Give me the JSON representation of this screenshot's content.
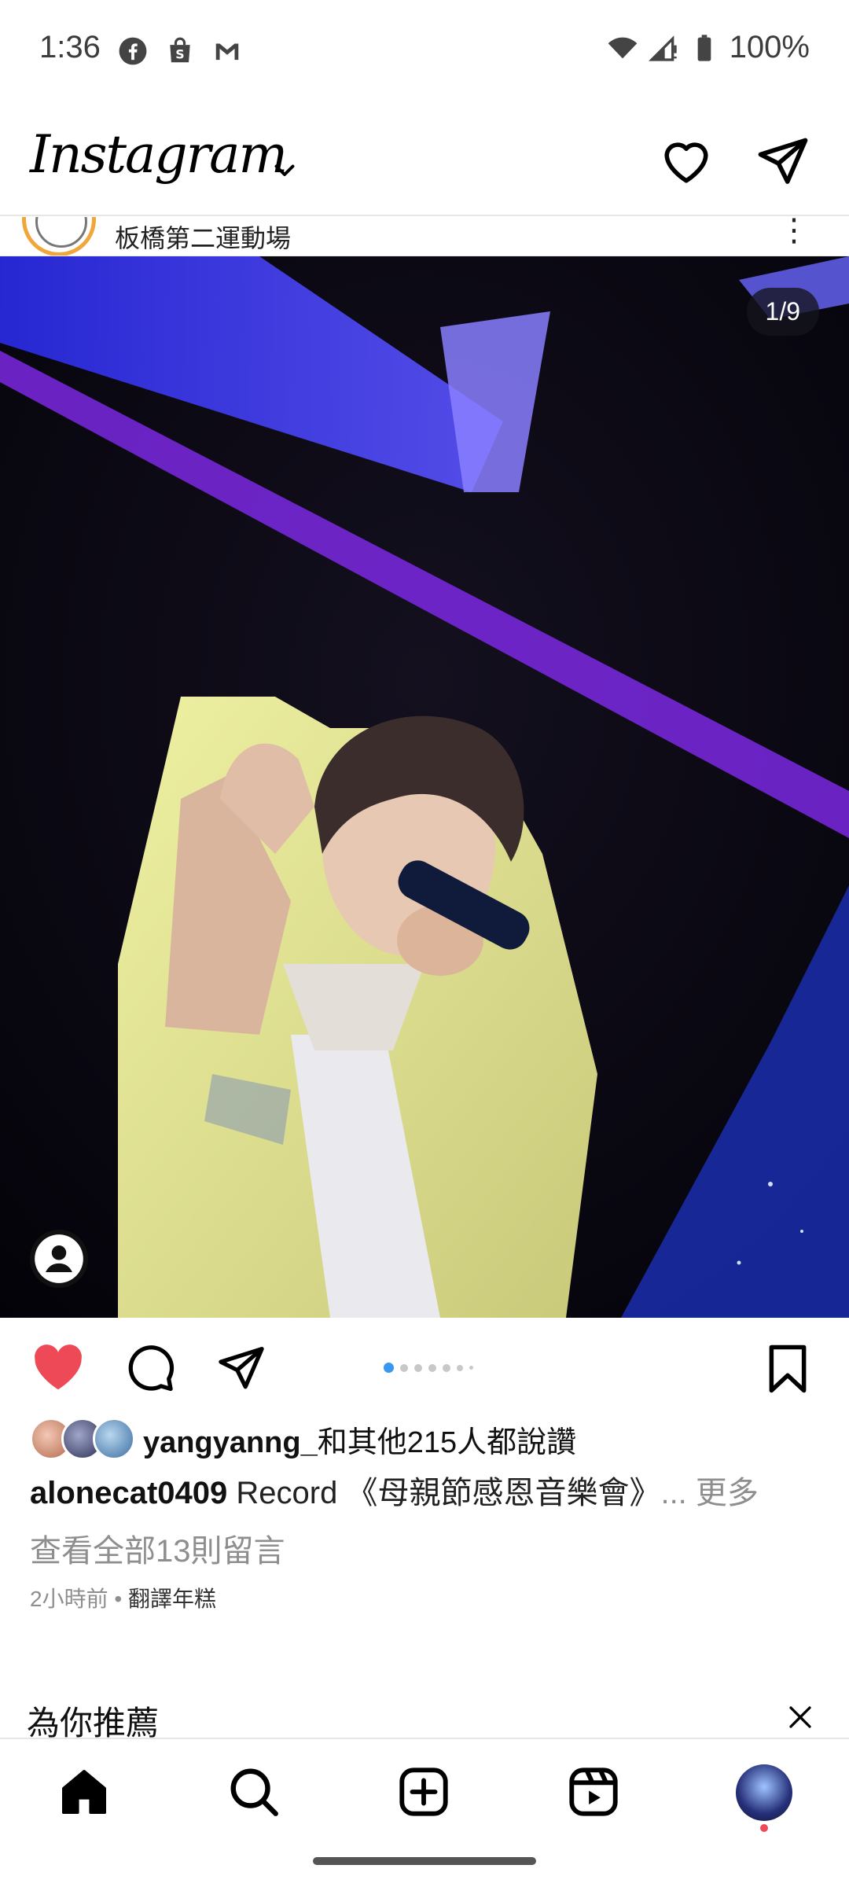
{
  "status_bar": {
    "time": "1:36",
    "app_icons": [
      "facebook-icon",
      "shop-icon",
      "gmail-icon"
    ],
    "battery": "100%"
  },
  "header": {
    "logo": "Instagram",
    "icons": [
      "activity-heart-icon",
      "direct-message-icon"
    ]
  },
  "post": {
    "location": "板橋第二運動場",
    "counter": "1/9",
    "carousel": {
      "total": 9,
      "current": 1,
      "visible_dots": 7
    },
    "likes": {
      "user": "yangyanng_",
      "rest": "和其他215人都說讚"
    },
    "caption": {
      "username": "alonecat0409",
      "text": " Record 《母親節感恩音樂會》",
      "ellipsis": "... ",
      "more": "更多"
    },
    "view_comments": "查看全部13則留言",
    "time_ago": "2小時前",
    "separator": " • ",
    "translate": "翻譯年糕",
    "liked": true
  },
  "suggestions": {
    "title": "為你推薦"
  },
  "bottom_nav": {
    "items": [
      "home-icon",
      "search-icon",
      "create-icon",
      "reels-icon",
      "profile-avatar"
    ],
    "has_notification_dot": true
  },
  "colors": {
    "like_red": "#ed4956",
    "active_dot": "#3897f0",
    "muted_text": "#8e8e8e"
  }
}
